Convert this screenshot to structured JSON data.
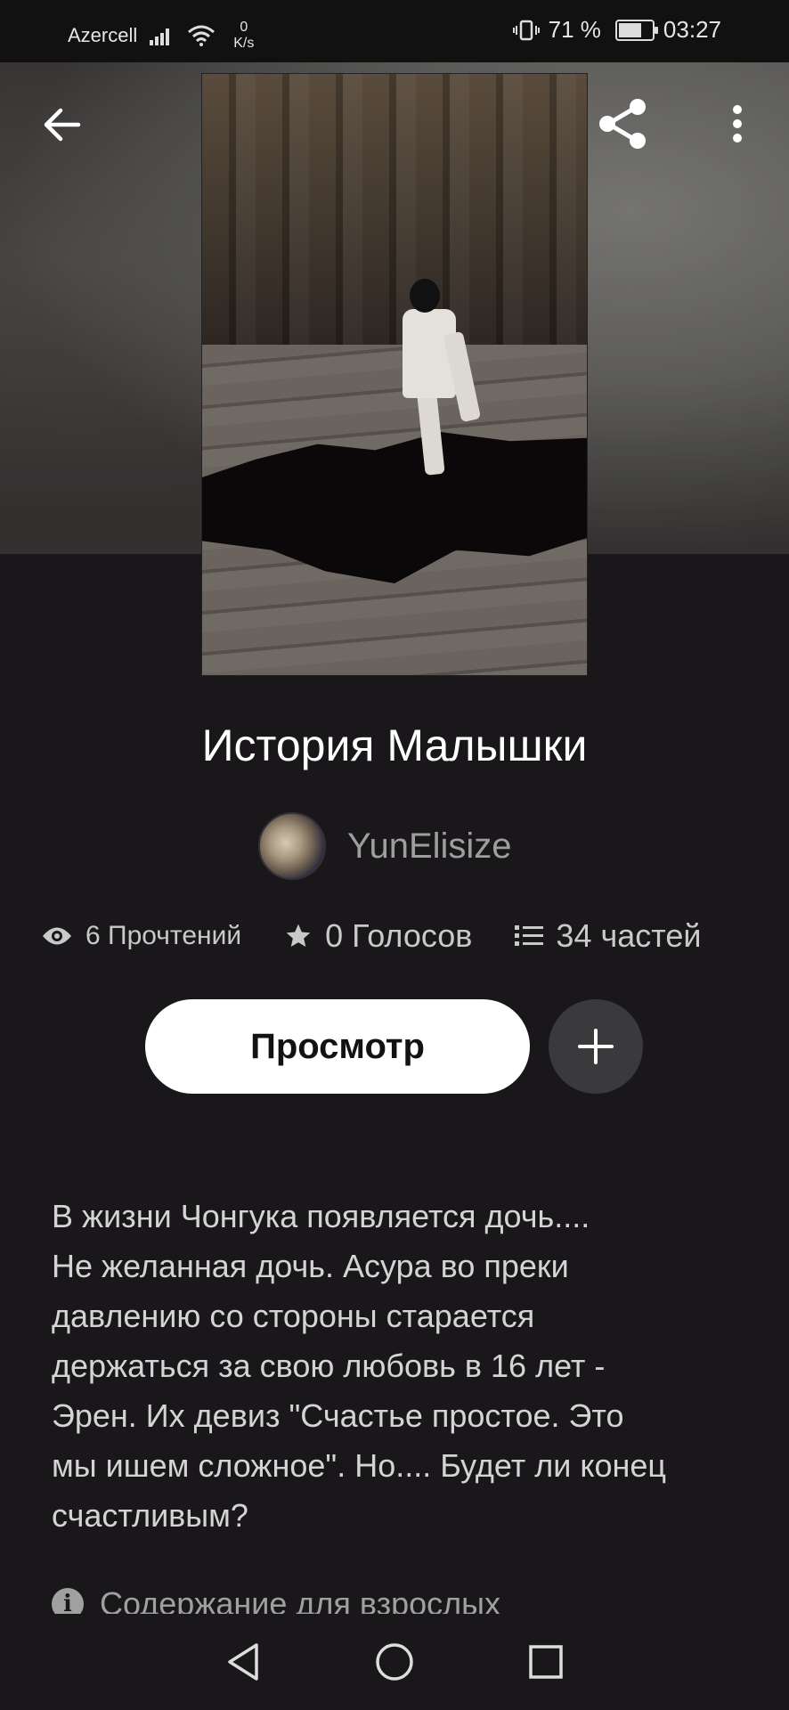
{
  "status_bar": {
    "carrier": "Azercell",
    "net_speed_value": "0",
    "net_speed_unit": "K/s",
    "battery_percent": "71 %",
    "battery_level": 0.71,
    "time": "03:27"
  },
  "story": {
    "title": "История Малышки",
    "author": "YunElisize",
    "reads": "6 Прочтений",
    "votes": "0 Голосов",
    "parts": "34 частей",
    "read_button": "Просмотр",
    "description": "В жизни Чонгука появляется дочь....\nНе желанная дочь. Асура во преки\nдавлению со стороны старается\nдержаться за свою любовь в 16 лет -\nЭрен. Их девиз \"Счастье простое. Это\nмы ишем сложное\". Но.... Будет ли конец\nсчастливым?",
    "mature_notice": "Содержание для взрослых"
  },
  "icons": {
    "back": "arrow-left-icon",
    "share": "share-icon",
    "more": "more-vertical-icon",
    "reads": "eye-icon",
    "votes": "star-icon",
    "parts": "list-icon",
    "add": "plus-icon",
    "info": "info-icon"
  }
}
